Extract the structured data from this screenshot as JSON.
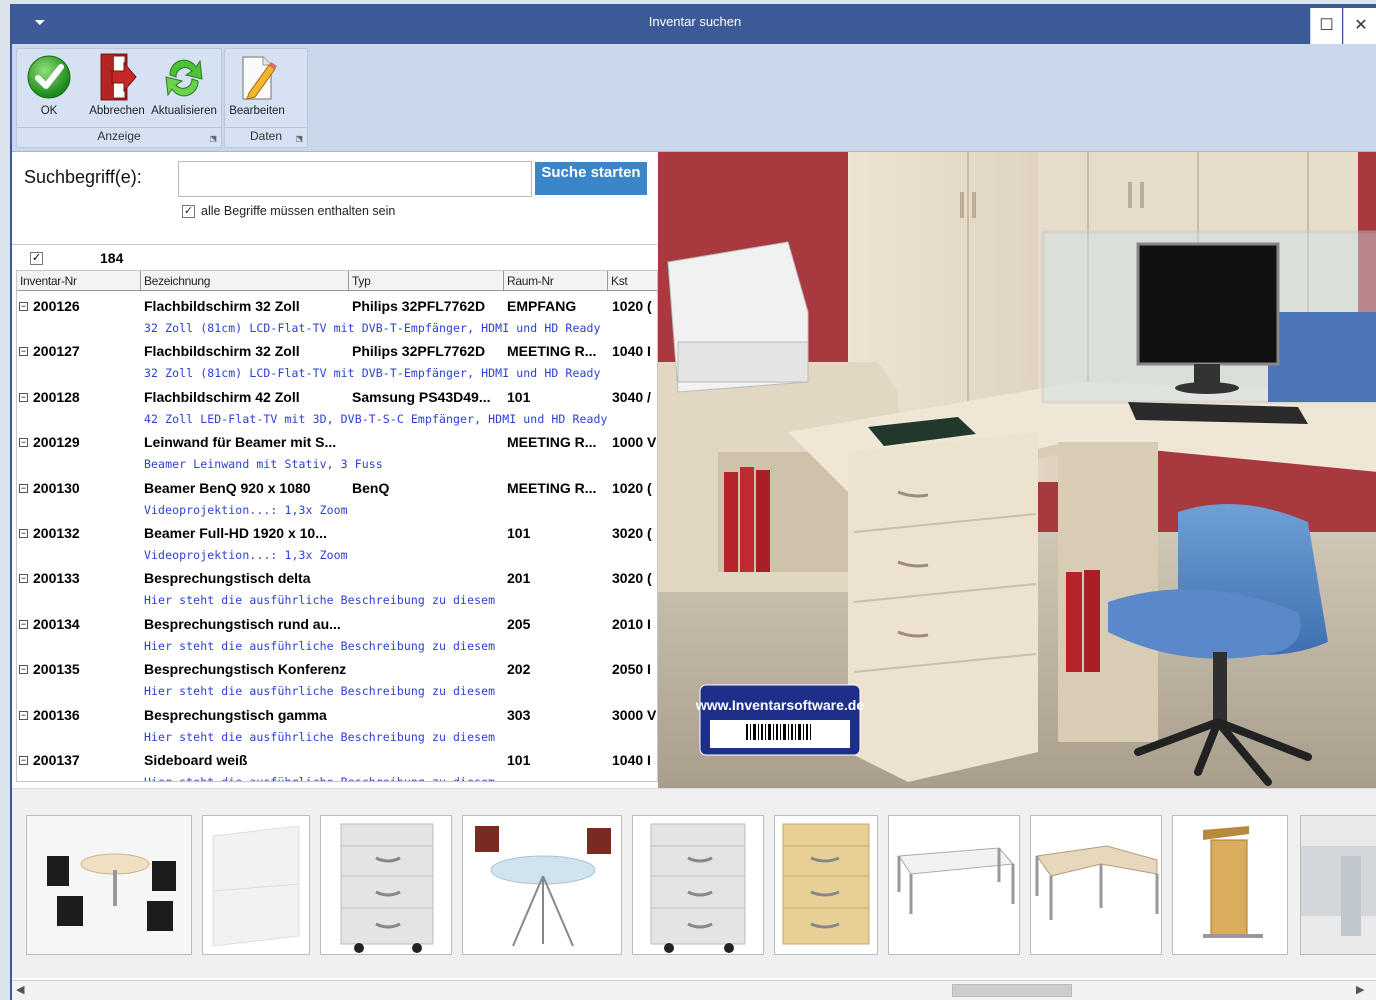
{
  "window": {
    "title": "Inventar suchen",
    "maximize_glyph": "☐",
    "close_glyph": "✕",
    "menu_glyph": "⏷"
  },
  "ribbon": {
    "groups": [
      {
        "label": "Anzeige",
        "buttons": [
          {
            "label": "OK",
            "icon": "checkmark-icon"
          },
          {
            "label": "Abbrechen",
            "icon": "exit-icon"
          },
          {
            "label": "Aktualisieren",
            "icon": "refresh-icon"
          }
        ]
      },
      {
        "label": "Daten",
        "buttons": [
          {
            "label": "Bearbeiten",
            "icon": "edit-icon"
          }
        ]
      }
    ]
  },
  "search": {
    "label": "Suchbegriff(e):",
    "value": "",
    "button": "Suche starten",
    "all_terms_label": "alle Begriffe müssen enthalten sein",
    "all_terms_checked": true
  },
  "results": {
    "count": "184",
    "columns": [
      "Inventar-Nr",
      "Bezeichnung",
      "Typ",
      "Raum-Nr",
      "Kst"
    ],
    "rows": [
      {
        "nr": "200126",
        "bez": "Flachbildschirm 32 Zoll",
        "typ": "Philips 32PFL7762D",
        "raum": "EMPFANG",
        "kst": "1020 (",
        "desc": "32 Zoll (81cm) LCD-Flat-TV mit DVB-T-Empfänger, HDMI und HD Ready"
      },
      {
        "nr": "200127",
        "bez": "Flachbildschirm 32 Zoll",
        "typ": "Philips 32PFL7762D",
        "raum": "MEETING R...",
        "kst": "1040 I",
        "desc": "32 Zoll (81cm) LCD-Flat-TV mit DVB-T-Empfänger, HDMI und HD Ready"
      },
      {
        "nr": "200128",
        "bez": "Flachbildschirm 42 Zoll",
        "typ": "Samsung PS43D49...",
        "raum": "101",
        "kst": "3040 /",
        "desc": "42 Zoll LED-Flat-TV mit 3D, DVB-T-S-C Empfänger, HDMI und HD Ready"
      },
      {
        "nr": "200129",
        "bez": "Leinwand für Beamer mit S...",
        "typ": "",
        "raum": "MEETING R...",
        "kst": "1000 V",
        "desc": "Beamer Leinwand mit Stativ, 3 Fuss"
      },
      {
        "nr": "200130",
        "bez": "Beamer BenQ 920 x 1080",
        "typ": "BenQ",
        "raum": "MEETING R...",
        "kst": "1020 (",
        "desc": "Videoprojektion...: 1,3x Zoom"
      },
      {
        "nr": "200132",
        "bez": "Beamer Full-HD 1920 x 10...",
        "typ": "",
        "raum": "101",
        "kst": "3020 (",
        "desc": "Videoprojektion...: 1,3x Zoom"
      },
      {
        "nr": "200133",
        "bez": "Besprechungstisch delta",
        "typ": "",
        "raum": "201",
        "kst": "3020 (",
        "desc": "Hier steht die ausführliche Beschreibung zu diesem"
      },
      {
        "nr": "200134",
        "bez": "Besprechungstisch rund au...",
        "typ": "",
        "raum": "205",
        "kst": "2010 I",
        "desc": "Hier steht die ausführliche Beschreibung zu diesem"
      },
      {
        "nr": "200135",
        "bez": "Besprechungstisch Konferenz",
        "typ": "",
        "raum": "202",
        "kst": "2050 I",
        "desc": "Hier steht die ausführliche Beschreibung zu diesem"
      },
      {
        "nr": "200136",
        "bez": "Besprechungstisch gamma",
        "typ": "",
        "raum": "303",
        "kst": "3000 V",
        "desc": "Hier steht die ausführliche Beschreibung zu diesem"
      },
      {
        "nr": "200137",
        "bez": "Sideboard weiß",
        "typ": "",
        "raum": "101",
        "kst": "1040 I",
        "desc": "Hier steht die ausführliche Beschreibung zu diesem"
      }
    ]
  },
  "photo": {
    "badge_text": "www.Inventarsoftware.de"
  },
  "thumbnails": [
    "conference-set-thumbnail",
    "sideboard-white-thumbnail",
    "drawer-cabinet-grey-thumbnail",
    "round-glass-table-thumbnail",
    "drawer-cabinet-grey-2-thumbnail",
    "drawer-cabinet-beech-thumbnail",
    "desk-white-thumbnail",
    "corner-desk-thumbnail",
    "lectern-thumbnail",
    "partial-room-thumbnail"
  ],
  "colors": {
    "titlebar": "#3d5a98",
    "ribbon": "#cad7eb",
    "search_button": "#3a86c8",
    "description_text": "#2b3fd6"
  }
}
